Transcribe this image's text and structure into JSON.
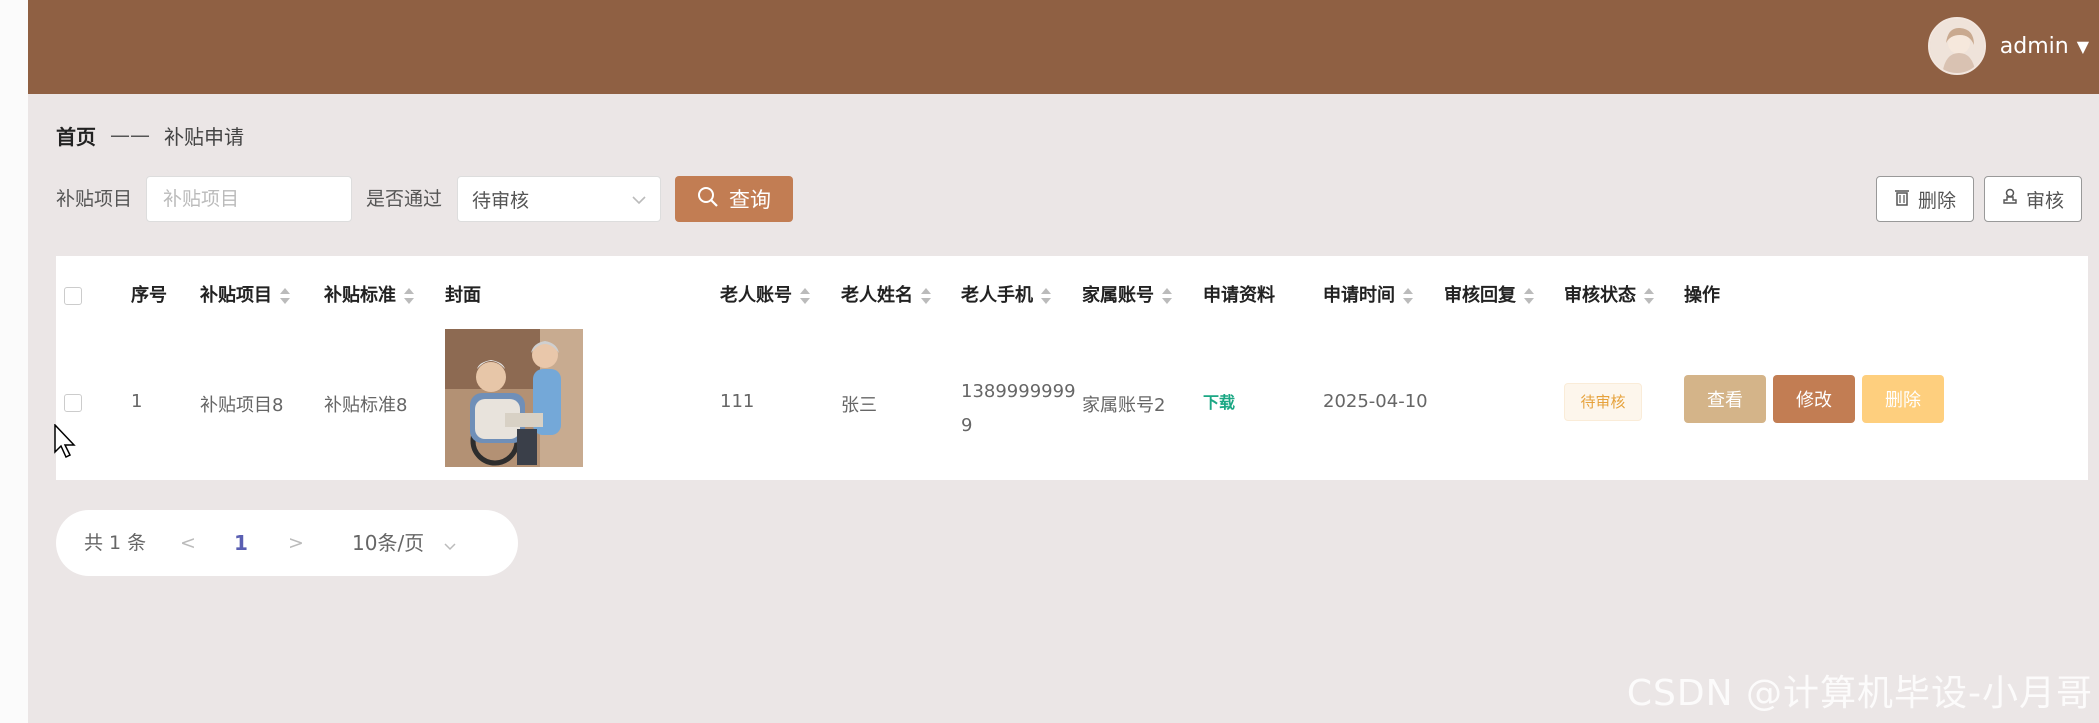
{
  "user": {
    "name": "admin"
  },
  "breadcrumb": {
    "home": "首页",
    "current": "补贴申请"
  },
  "filters": {
    "project_label": "补贴项目",
    "project_placeholder": "补贴项目",
    "pass_label": "是否通过",
    "pass_value": "待审核",
    "query_label": "查询"
  },
  "toolbar": {
    "delete_label": "删除",
    "review_label": "审核"
  },
  "table": {
    "headers": {
      "index": "序号",
      "project": "补贴项目",
      "standard": "补贴标准",
      "cover": "封面",
      "elder_account": "老人账号",
      "elder_name": "老人姓名",
      "elder_phone": "老人手机",
      "family_account": "家属账号",
      "materials": "申请资料",
      "apply_time": "申请时间",
      "review_reply": "审核回复",
      "review_status": "审核状态",
      "actions": "操作"
    },
    "rows": [
      {
        "index": "1",
        "project": "补贴项目8",
        "standard": "补贴标准8",
        "elder_account": "111",
        "elder_name": "张三",
        "elder_phone_line1": "1389999999",
        "elder_phone_line2": "9",
        "family_account": "家属账号2",
        "materials": "下载",
        "apply_time": "2025-04-10",
        "review_reply": "",
        "review_status": "待审核",
        "actions": {
          "view": "查看",
          "edit": "修改",
          "delete": "删除"
        }
      }
    ]
  },
  "pagination": {
    "total": "共 1 条",
    "prev": "<",
    "page": "1",
    "next": ">",
    "page_size": "10条/页"
  },
  "watermark": "CSDN @计算机毕设-小月哥",
  "colors": {
    "header": "#8f6043",
    "primary": "#c27d53",
    "view_button": "#d4b489",
    "delete_button": "#fecf7e",
    "status_tag": "#e6a23c",
    "download_link": "#1ba784",
    "page_active": "#5a5fb2"
  }
}
